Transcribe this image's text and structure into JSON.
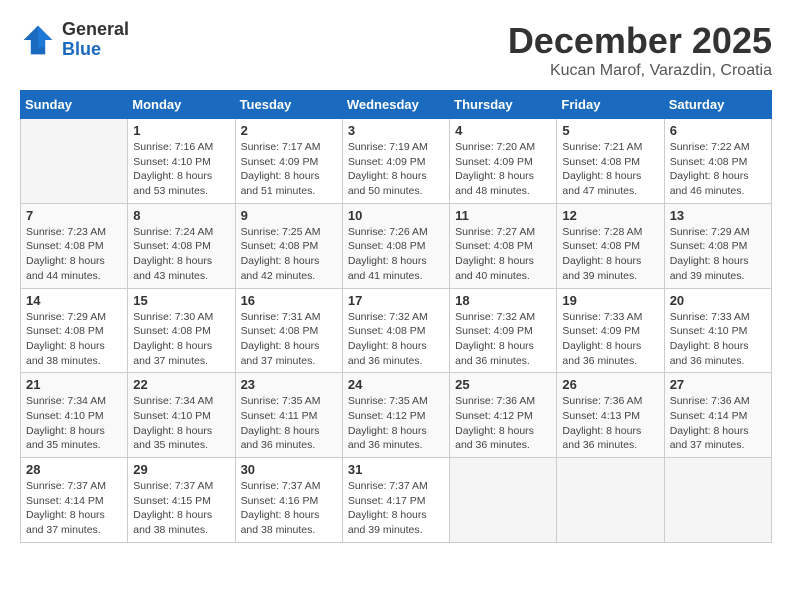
{
  "header": {
    "logo_general": "General",
    "logo_blue": "Blue",
    "title": "December 2025",
    "location": "Kucan Marof, Varazdin, Croatia"
  },
  "calendar": {
    "days_of_week": [
      "Sunday",
      "Monday",
      "Tuesday",
      "Wednesday",
      "Thursday",
      "Friday",
      "Saturday"
    ],
    "weeks": [
      [
        {
          "day": "",
          "info": ""
        },
        {
          "day": "1",
          "info": "Sunrise: 7:16 AM\nSunset: 4:10 PM\nDaylight: 8 hours\nand 53 minutes."
        },
        {
          "day": "2",
          "info": "Sunrise: 7:17 AM\nSunset: 4:09 PM\nDaylight: 8 hours\nand 51 minutes."
        },
        {
          "day": "3",
          "info": "Sunrise: 7:19 AM\nSunset: 4:09 PM\nDaylight: 8 hours\nand 50 minutes."
        },
        {
          "day": "4",
          "info": "Sunrise: 7:20 AM\nSunset: 4:09 PM\nDaylight: 8 hours\nand 48 minutes."
        },
        {
          "day": "5",
          "info": "Sunrise: 7:21 AM\nSunset: 4:08 PM\nDaylight: 8 hours\nand 47 minutes."
        },
        {
          "day": "6",
          "info": "Sunrise: 7:22 AM\nSunset: 4:08 PM\nDaylight: 8 hours\nand 46 minutes."
        }
      ],
      [
        {
          "day": "7",
          "info": "Sunrise: 7:23 AM\nSunset: 4:08 PM\nDaylight: 8 hours\nand 44 minutes."
        },
        {
          "day": "8",
          "info": "Sunrise: 7:24 AM\nSunset: 4:08 PM\nDaylight: 8 hours\nand 43 minutes."
        },
        {
          "day": "9",
          "info": "Sunrise: 7:25 AM\nSunset: 4:08 PM\nDaylight: 8 hours\nand 42 minutes."
        },
        {
          "day": "10",
          "info": "Sunrise: 7:26 AM\nSunset: 4:08 PM\nDaylight: 8 hours\nand 41 minutes."
        },
        {
          "day": "11",
          "info": "Sunrise: 7:27 AM\nSunset: 4:08 PM\nDaylight: 8 hours\nand 40 minutes."
        },
        {
          "day": "12",
          "info": "Sunrise: 7:28 AM\nSunset: 4:08 PM\nDaylight: 8 hours\nand 39 minutes."
        },
        {
          "day": "13",
          "info": "Sunrise: 7:29 AM\nSunset: 4:08 PM\nDaylight: 8 hours\nand 39 minutes."
        }
      ],
      [
        {
          "day": "14",
          "info": "Sunrise: 7:29 AM\nSunset: 4:08 PM\nDaylight: 8 hours\nand 38 minutes."
        },
        {
          "day": "15",
          "info": "Sunrise: 7:30 AM\nSunset: 4:08 PM\nDaylight: 8 hours\nand 37 minutes."
        },
        {
          "day": "16",
          "info": "Sunrise: 7:31 AM\nSunset: 4:08 PM\nDaylight: 8 hours\nand 37 minutes."
        },
        {
          "day": "17",
          "info": "Sunrise: 7:32 AM\nSunset: 4:08 PM\nDaylight: 8 hours\nand 36 minutes."
        },
        {
          "day": "18",
          "info": "Sunrise: 7:32 AM\nSunset: 4:09 PM\nDaylight: 8 hours\nand 36 minutes."
        },
        {
          "day": "19",
          "info": "Sunrise: 7:33 AM\nSunset: 4:09 PM\nDaylight: 8 hours\nand 36 minutes."
        },
        {
          "day": "20",
          "info": "Sunrise: 7:33 AM\nSunset: 4:10 PM\nDaylight: 8 hours\nand 36 minutes."
        }
      ],
      [
        {
          "day": "21",
          "info": "Sunrise: 7:34 AM\nSunset: 4:10 PM\nDaylight: 8 hours\nand 35 minutes."
        },
        {
          "day": "22",
          "info": "Sunrise: 7:34 AM\nSunset: 4:10 PM\nDaylight: 8 hours\nand 35 minutes."
        },
        {
          "day": "23",
          "info": "Sunrise: 7:35 AM\nSunset: 4:11 PM\nDaylight: 8 hours\nand 36 minutes."
        },
        {
          "day": "24",
          "info": "Sunrise: 7:35 AM\nSunset: 4:12 PM\nDaylight: 8 hours\nand 36 minutes."
        },
        {
          "day": "25",
          "info": "Sunrise: 7:36 AM\nSunset: 4:12 PM\nDaylight: 8 hours\nand 36 minutes."
        },
        {
          "day": "26",
          "info": "Sunrise: 7:36 AM\nSunset: 4:13 PM\nDaylight: 8 hours\nand 36 minutes."
        },
        {
          "day": "27",
          "info": "Sunrise: 7:36 AM\nSunset: 4:14 PM\nDaylight: 8 hours\nand 37 minutes."
        }
      ],
      [
        {
          "day": "28",
          "info": "Sunrise: 7:37 AM\nSunset: 4:14 PM\nDaylight: 8 hours\nand 37 minutes."
        },
        {
          "day": "29",
          "info": "Sunrise: 7:37 AM\nSunset: 4:15 PM\nDaylight: 8 hours\nand 38 minutes."
        },
        {
          "day": "30",
          "info": "Sunrise: 7:37 AM\nSunset: 4:16 PM\nDaylight: 8 hours\nand 38 minutes."
        },
        {
          "day": "31",
          "info": "Sunrise: 7:37 AM\nSunset: 4:17 PM\nDaylight: 8 hours\nand 39 minutes."
        },
        {
          "day": "",
          "info": ""
        },
        {
          "day": "",
          "info": ""
        },
        {
          "day": "",
          "info": ""
        }
      ]
    ]
  }
}
